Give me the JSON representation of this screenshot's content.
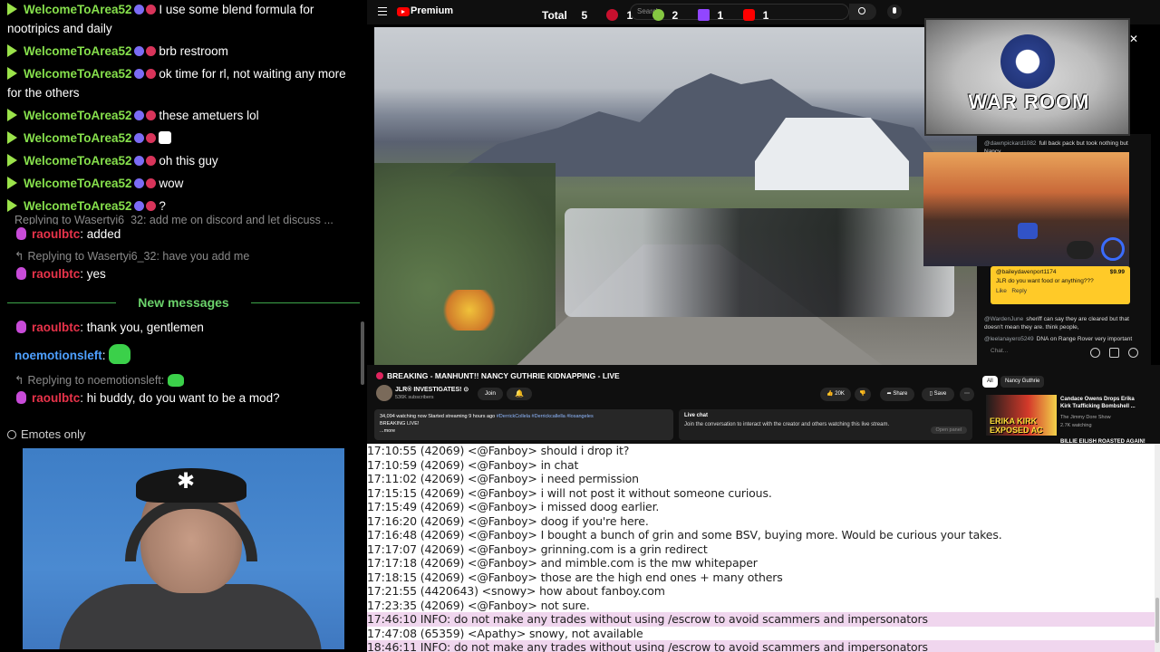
{
  "chat": {
    "messages": [
      {
        "user": "WelcomeToArea52",
        "text": "I use some blend formula for nootripics and daily"
      },
      {
        "user": "WelcomeToArea52",
        "text": "brb restroom"
      },
      {
        "user": "WelcomeToArea52",
        "text": "ok time for rl, not waiting any more for the others"
      },
      {
        "user": "WelcomeToArea52",
        "text": "these ametuers lol"
      },
      {
        "user": "WelcomeToArea52",
        "text": ""
      },
      {
        "user": "WelcomeToArea52",
        "text": "oh this guy"
      },
      {
        "user": "WelcomeToArea52",
        "text": "wow"
      },
      {
        "user": "WelcomeToArea52",
        "text": "?"
      }
    ],
    "reply_cut": "Replying to Wasertyi6_32: add me on discord and let discuss ...",
    "m_added": {
      "user": "raoulbtc",
      "text": ": added"
    },
    "reply2": "Replying to Wasertyi6_32: have you add me",
    "m_yes": {
      "user": "raoulbtc",
      "text": ": yes"
    },
    "new_messages": "New messages",
    "m_thanks": {
      "user": "raoulbtc",
      "text": ": thank you, gentlemen"
    },
    "m_noemotion": {
      "user": "noemotionsleft",
      "text": ":"
    },
    "reply3": "Replying to noemotionsleft:",
    "m_mod": {
      "user": "raoulbtc",
      "text": ": hi buddy, do you want to be a mod?"
    },
    "emotes_only": "Emotes only"
  },
  "youtube": {
    "brand": "Premium",
    "search_placeholder": "Search",
    "counters": {
      "total_label": "Total",
      "total": "5",
      "c1": "1",
      "c2": "2",
      "c3": "1",
      "c4": "1"
    },
    "video_title": "BREAKING - MANHUNT!! NANCY GUTHRIE KIDNAPPING - LIVE",
    "channel": "JLR® INVESTIGATES! ⊙",
    "subs": "536K subscribers",
    "join": "Join",
    "likes": "20K",
    "share": "Share",
    "save": "Save",
    "desc_line1": "34,094 watching now  Started streaming 9 hours ago ",
    "desc_tags": "#DerrickCollela #Derrickcallella #losangeles",
    "desc_line2": "BREAKING LIVE!",
    "desc_more": "...more",
    "livechat_title": "Live chat",
    "livechat_text": "Join the conversation to interact with the creator and others watching this live stream.",
    "livechat_open": "Open panel",
    "pip_title": "WAR ROOM",
    "superchat": {
      "user": "@baileydavenport1174",
      "amount": "$9.99",
      "text": "JLR do you want food or anything???",
      "like": "Like",
      "reply": "Reply"
    },
    "livechat_lines": [
      {
        "name": "@dawnpickard1082",
        "text": "full back pack but took nothing but Nancy"
      },
      {
        "name": "@WardenJune",
        "text": "sheriff can say they are cleared but that doesn't mean they are. think people,"
      },
      {
        "name": "@leelanayero5249",
        "text": "DNA on Range Rover very important"
      }
    ],
    "chat_input": "Chat...",
    "chips": [
      "All",
      "Nancy Guthrie"
    ],
    "rec1": {
      "thumb_text": "ERIKA KIRK EXPOSED AC",
      "title": "Candace Owens Drops Erika Kirk Trafficking Bombshell ...",
      "channel": "The Jimmy Dore Show",
      "watching": "2.7K watching"
    },
    "rec2_title": "BILLIE EILISH ROASTED AGAIN!"
  },
  "irc": [
    {
      "text": "17:10:55 (42069) <@Fanboy> should i drop it?",
      "info": false
    },
    {
      "text": "17:10:59 (42069) <@Fanboy> in chat",
      "info": false
    },
    {
      "text": "17:11:02 (42069) <@Fanboy> i need permission",
      "info": false
    },
    {
      "text": "17:15:15 (42069) <@Fanboy> i will not post it without someone curious.",
      "info": false
    },
    {
      "text": "17:15:49 (42069) <@Fanboy> i missed doog earlier.",
      "info": false
    },
    {
      "text": "17:16:20 (42069) <@Fanboy> doog if you're here.",
      "info": false
    },
    {
      "text": "17:16:48 (42069) <@Fanboy> I bought a bunch of grin and some BSV, buying more. Would be curious your takes.",
      "info": false
    },
    {
      "text": "17:17:07 (42069) <@Fanboy> grinning.com is a grin redirect",
      "info": false
    },
    {
      "text": "17:17:18 (42069) <@Fanboy> and mimble.com is the mw whitepaper",
      "info": false
    },
    {
      "text": "17:18:15 (42069) <@Fanboy> those are the high end ones + many others",
      "info": false
    },
    {
      "text": "17:21:55 (4420643) <snowy> how about fanboy.com",
      "info": false
    },
    {
      "text": "17:23:35 (42069) <@Fanboy> not sure.",
      "info": false
    },
    {
      "text": "17:46:10 INFO: do not make any trades without using /escrow to avoid scammers and impersonators",
      "info": true
    },
    {
      "text": "17:47:08 (65359) <Apathy> snowy, not available",
      "info": false
    },
    {
      "text": "18:46:11 INFO: do not make any trades without using /escrow to avoid scammers and impersonators",
      "info": true
    }
  ]
}
